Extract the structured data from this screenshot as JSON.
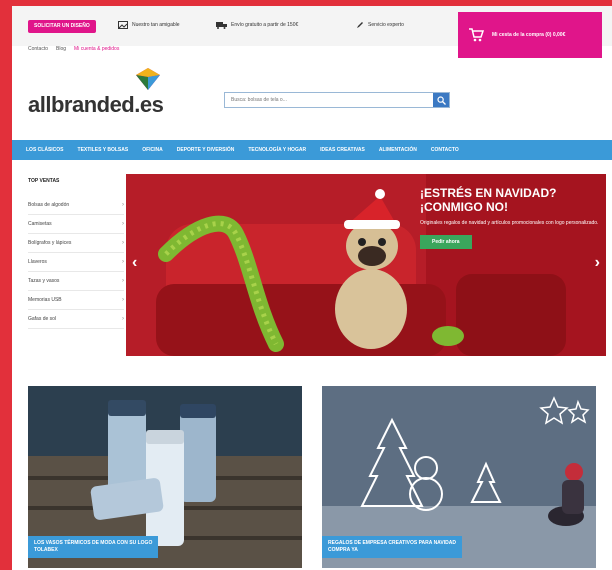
{
  "header": {
    "promo_pill": "SOLICITAR UN DISEÑO",
    "util_items": [
      {
        "icon": "image-icon",
        "label": "Nuestro tan amigable"
      },
      {
        "icon": "truck-icon",
        "label": "Envío gratuito a partir de 150€"
      },
      {
        "icon": "pencil-icon",
        "label": "Servicio experto"
      }
    ],
    "cart_label": "Mi cesta de la compra (0) 0,00€",
    "sub_links": [
      "Contacto",
      "Blog",
      "Mi cuenta & pedidos"
    ]
  },
  "logo": {
    "text": "allbranded.es"
  },
  "search": {
    "placeholder": "Busca: bolsas de tela o..."
  },
  "nav": {
    "items": [
      "LOS CLÁSICOS",
      "TEXTILES Y BOLSAS",
      "OFICINA",
      "DEPORTE Y DIVERSIÓN",
      "TECNOLOGÍA Y HOGAR",
      "IDEAS CREATIVAS",
      "ALIMENTACIÓN",
      "CONTACTO"
    ]
  },
  "sidebar": {
    "title": "TOP VENTAS",
    "items": [
      "Bolsas de algodón",
      "Camisetas",
      "Bolígrafos y lápices",
      "Llaveros",
      "Tazas y vasos",
      "Memorias USB",
      "Gafas de sol"
    ]
  },
  "hero": {
    "headline_line1": "¡ESTRÉS EN NAVIDAD?",
    "headline_line2": "¡CONMIGO NO!",
    "subtext": "Originales regalos de navidad y artículos promocionales con logo personalizado.",
    "button": "Pedir ahora",
    "prev": "‹",
    "next": "›"
  },
  "cards": [
    {
      "caption_line1": "LOS VASOS TÉRMICOS DE MODA CON SU LOGO",
      "caption_line2": "TOLABEX"
    },
    {
      "caption_line1": "REGALOS DE EMPRESA CREATIVOS PARA NAVIDAD",
      "caption_line2": "COMPRA YA"
    }
  ],
  "colors": {
    "brand_pink": "#e0158a",
    "nav_blue": "#3b9ad8",
    "hero_red": "#b11c26",
    "frame_red": "#e2303b"
  }
}
